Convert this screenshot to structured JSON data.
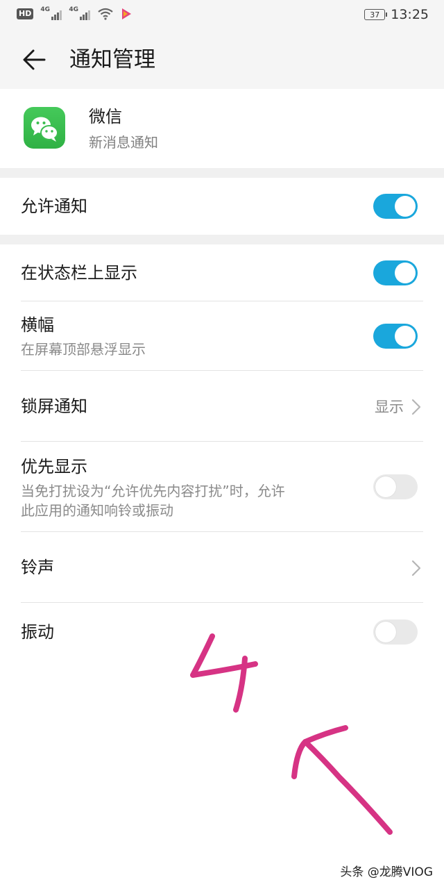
{
  "status_bar": {
    "hd": "HD",
    "net1": "4G",
    "net2": "4G",
    "battery": "37",
    "time": "13:25"
  },
  "header": {
    "title": "通知管理"
  },
  "app": {
    "name": "微信",
    "subtitle": "新消息通知"
  },
  "settings": {
    "allow": {
      "title": "允许通知",
      "on": true
    },
    "statusbar": {
      "title": "在状态栏上显示",
      "on": true
    },
    "banner": {
      "title": "横幅",
      "subtitle": "在屏幕顶部悬浮显示",
      "on": true
    },
    "lockscreen": {
      "title": "锁屏通知",
      "value": "显示"
    },
    "priority": {
      "title": "优先显示",
      "subtitle_line1": "当免打扰设为“允许优先内容打扰”时，允许",
      "subtitle_line2": "此应用的通知响铃或振动",
      "on": false
    },
    "ringtone": {
      "title": "铃声"
    },
    "vibration": {
      "title": "振动",
      "on": false
    }
  },
  "colors": {
    "accent": "#1aa7dc",
    "annotation": "#d63384",
    "app_icon": "#3bbd4f"
  },
  "annotation": {
    "digit": "4",
    "arrow": "up-left arrow"
  },
  "watermark": "头条 @龙腾VIOG"
}
